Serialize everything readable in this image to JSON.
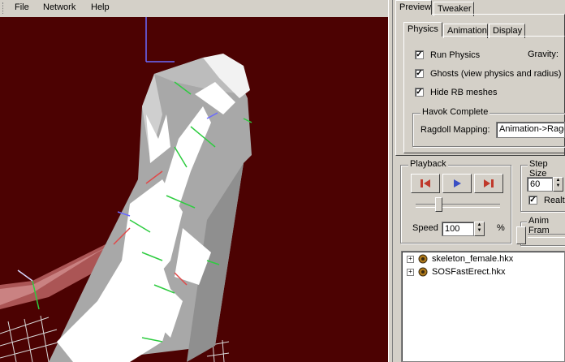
{
  "menu": {
    "file": "File",
    "network": "Network",
    "help": "Help"
  },
  "tabs": {
    "preview": "Preview",
    "tweaker": "Tweaker"
  },
  "subtabs": {
    "physics": "Physics",
    "animation": "Animation",
    "display": "Display"
  },
  "physics": {
    "run_physics": "Run Physics",
    "gravity": "Gravity:",
    "ghosts": "Ghosts (view physics and radius)",
    "hide_rb": "Hide RB meshes",
    "havok_group": "Havok Complete",
    "ragdoll_label": "Ragdoll Mapping:",
    "ragdoll_value": "Animation->Ragd"
  },
  "playback": {
    "group": "Playback",
    "speed_label": "Speed",
    "speed_value": "100",
    "percent": "%",
    "slider_level": 0.27
  },
  "step": {
    "group": "Step Size",
    "value": "60",
    "realtime": "Realt"
  },
  "anim_frame": {
    "label": "Anim Fram"
  },
  "tree": {
    "items": [
      {
        "label": "skeleton_female.hkx",
        "expander": "+"
      },
      {
        "label": "SOSFastErect.hkx",
        "expander": "+"
      }
    ]
  },
  "checks": {
    "mark": "✓"
  },
  "colors": {
    "viewport_bg": "#4c0202",
    "panel_bg": "#d4d0c8",
    "play_red": "#c0392b",
    "play_blue": "#3a4fc4"
  }
}
